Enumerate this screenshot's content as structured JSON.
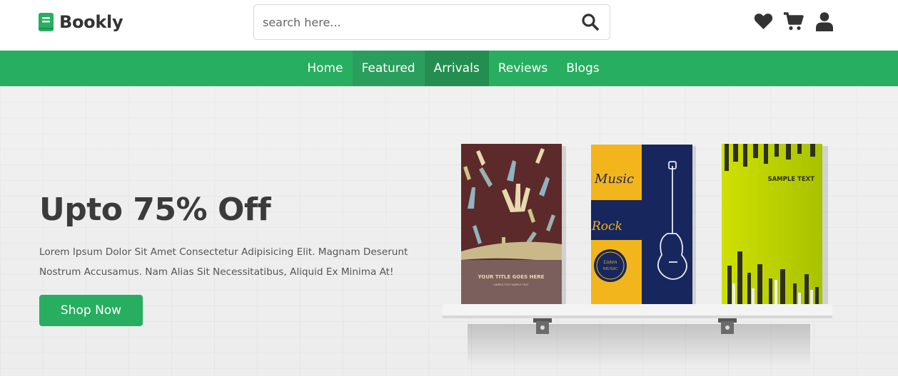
{
  "brand": {
    "name": "Bookly",
    "icon": "book-icon",
    "accent": "#27ae60"
  },
  "search": {
    "placeholder": "search here...",
    "icon": "search-icon"
  },
  "header_icons": [
    {
      "name": "heart-icon"
    },
    {
      "name": "cart-icon"
    },
    {
      "name": "user-icon"
    }
  ],
  "nav": {
    "items": [
      {
        "label": "Home"
      },
      {
        "label": "Featured"
      },
      {
        "label": "Arrivals"
      },
      {
        "label": "Reviews"
      },
      {
        "label": "Blogs"
      }
    ]
  },
  "hero": {
    "title": "Upto 75% Off",
    "description": "Lorem Ipsum Dolor Sit Amet Consectetur Adipisicing Elit. Magnam Deserunt Nostrum Accusamus. Nam Alias Sit Necessitatibus, Aliquid Ex Minima At!",
    "cta_label": "Shop Now"
  },
  "books": [
    {
      "cover_title": "YOUR TITLE GOES HERE",
      "cover_sub": "SAMPLE TEXT SAMPLE TEXT"
    },
    {
      "cover_title": "Music",
      "cover_sub": "Rock",
      "badge_text": "Listen MUSIC is always a good idea"
    },
    {
      "cover_title": "SAMPLE TEXT"
    }
  ]
}
